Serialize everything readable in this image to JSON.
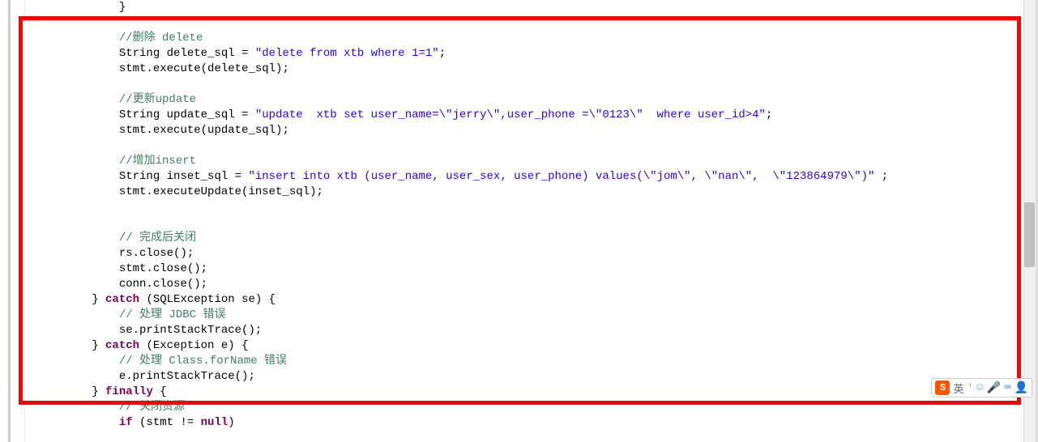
{
  "code": {
    "lines": [
      {
        "indent": 12,
        "parts": [
          {
            "t": "plain",
            "v": "}"
          }
        ]
      },
      {
        "indent": 12,
        "parts": []
      },
      {
        "indent": 12,
        "parts": [
          {
            "t": "comment",
            "v": "//删除 delete"
          }
        ]
      },
      {
        "indent": 12,
        "parts": [
          {
            "t": "plain",
            "v": "String delete_sql = "
          },
          {
            "t": "string",
            "v": "\"delete from xtb where 1=1\""
          },
          {
            "t": "plain",
            "v": ";"
          }
        ]
      },
      {
        "indent": 12,
        "parts": [
          {
            "t": "plain",
            "v": "stmt.execute(delete_sql);"
          }
        ]
      },
      {
        "indent": 12,
        "parts": []
      },
      {
        "indent": 12,
        "parts": [
          {
            "t": "comment",
            "v": "//更新update"
          }
        ]
      },
      {
        "indent": 12,
        "parts": [
          {
            "t": "plain",
            "v": "String update_sql = "
          },
          {
            "t": "string",
            "v": "\"update  xtb set user_name=\\\"jerry\\\",user_phone =\\\"0123\\\"  where user_id>4\""
          },
          {
            "t": "plain",
            "v": ";"
          }
        ]
      },
      {
        "indent": 12,
        "parts": [
          {
            "t": "plain",
            "v": "stmt.execute(update_sql);"
          }
        ]
      },
      {
        "indent": 12,
        "parts": []
      },
      {
        "indent": 12,
        "parts": [
          {
            "t": "comment",
            "v": "//增加insert"
          }
        ]
      },
      {
        "indent": 12,
        "parts": [
          {
            "t": "plain",
            "v": "String inset_sql = "
          },
          {
            "t": "string",
            "v": "\"insert into xtb (user_name, user_sex, user_phone) values(\\\"jom\\\", \\\"nan\\\",  \\\"123864979\\\")\""
          },
          {
            "t": "plain",
            "v": " ;"
          }
        ]
      },
      {
        "indent": 12,
        "parts": [
          {
            "t": "plain",
            "v": "stmt.executeUpdate(inset_sql);"
          }
        ]
      },
      {
        "indent": 12,
        "parts": []
      },
      {
        "indent": 12,
        "parts": []
      },
      {
        "indent": 12,
        "parts": [
          {
            "t": "comment",
            "v": "// 完成后关闭"
          }
        ]
      },
      {
        "indent": 12,
        "parts": [
          {
            "t": "plain",
            "v": "rs.close();"
          }
        ]
      },
      {
        "indent": 12,
        "parts": [
          {
            "t": "plain",
            "v": "stmt.close();"
          }
        ]
      },
      {
        "indent": 12,
        "parts": [
          {
            "t": "plain",
            "v": "conn.close();"
          }
        ]
      },
      {
        "indent": 8,
        "parts": [
          {
            "t": "plain",
            "v": "} "
          },
          {
            "t": "keyword",
            "v": "catch"
          },
          {
            "t": "plain",
            "v": " (SQLException se) {"
          }
        ]
      },
      {
        "indent": 12,
        "parts": [
          {
            "t": "comment",
            "v": "// 处理 JDBC 错误"
          }
        ]
      },
      {
        "indent": 12,
        "parts": [
          {
            "t": "plain",
            "v": "se.printStackTrace();"
          }
        ]
      },
      {
        "indent": 8,
        "parts": [
          {
            "t": "plain",
            "v": "} "
          },
          {
            "t": "keyword",
            "v": "catch"
          },
          {
            "t": "plain",
            "v": " (Exception e) {"
          }
        ]
      },
      {
        "indent": 12,
        "parts": [
          {
            "t": "comment",
            "v": "// 处理 Class.forName 错误"
          }
        ]
      },
      {
        "indent": 12,
        "parts": [
          {
            "t": "plain",
            "v": "e.printStackTrace();"
          }
        ]
      },
      {
        "indent": 8,
        "parts": [
          {
            "t": "plain",
            "v": "} "
          },
          {
            "t": "keyword",
            "v": "finally"
          },
          {
            "t": "plain",
            "v": " {"
          }
        ]
      },
      {
        "indent": 12,
        "parts": [
          {
            "t": "comment",
            "v": "// 关闭资源"
          }
        ]
      },
      {
        "indent": 12,
        "parts": [
          {
            "t": "keyword",
            "v": "if"
          },
          {
            "t": "plain",
            "v": " (stmt != "
          },
          {
            "t": "keyword",
            "v": "null"
          },
          {
            "t": "plain",
            "v": ")"
          }
        ]
      }
    ]
  },
  "ime": {
    "logo": "S",
    "lang": "英",
    "sep": "'",
    "icons": [
      "☺",
      "🎤",
      "⌨",
      "👤"
    ]
  }
}
